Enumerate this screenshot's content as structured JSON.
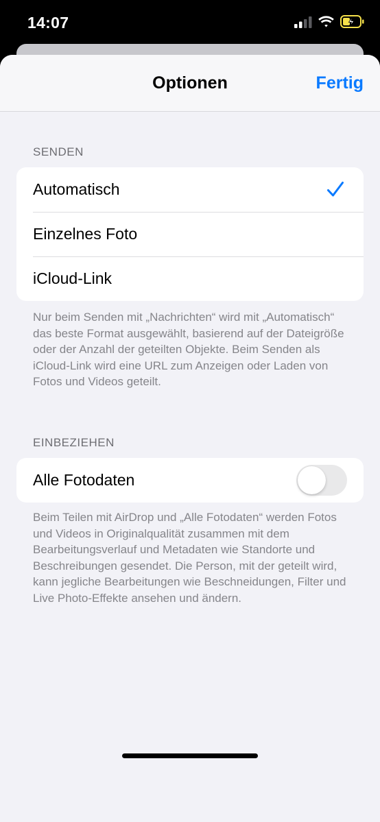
{
  "status_bar": {
    "time": "14:07",
    "icons": [
      "cellular-signal-icon",
      "wifi-icon",
      "battery-charging-icon"
    ]
  },
  "nav": {
    "title": "Optionen",
    "done_label": "Fertig"
  },
  "send_section": {
    "header": "SENDEN",
    "options": [
      {
        "label": "Automatisch",
        "selected": true
      },
      {
        "label": "Einzelnes Foto",
        "selected": false
      },
      {
        "label": "iCloud-Link",
        "selected": false
      }
    ],
    "footer": "Nur beim Senden mit „Nachrichten“ wird mit „Automatisch“ das beste Format ausgewählt, basierend auf der Dateigröße oder der Anzahl der geteilten Objekte. Beim Senden als iCloud-Link wird eine URL zum Anzeigen oder Laden von Fotos und Videos geteilt."
  },
  "include_section": {
    "header": "EINBEZIEHEN",
    "all_photo_data": {
      "label": "Alle Fotodaten",
      "enabled": false
    },
    "footer": "Beim Teilen mit AirDrop und „Alle Fotodaten“ werden Fotos und Videos in Originalqualität zusammen mit dem Bearbeitungsverlauf und Metadaten wie Standorte und Beschreibungen gesendet. Die Person, mit der geteilt wird, kann jegliche Bearbeitungen wie Beschneidungen, Filter und Live Photo-Effekte ansehen und ändern."
  },
  "colors": {
    "accent": "#0a7aff",
    "background": "#f2f2f7",
    "secondary_text": "#85858a",
    "toggle_off": "#e9e9ea"
  }
}
